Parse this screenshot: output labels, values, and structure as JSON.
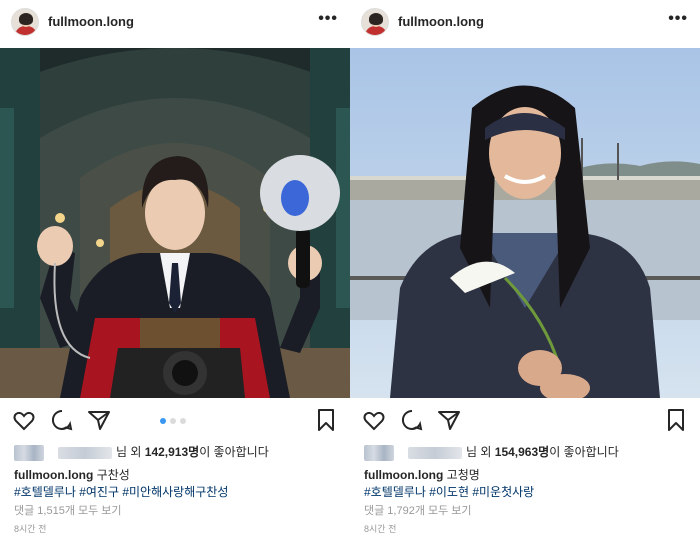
{
  "posts": [
    {
      "username": "fullmoon.long",
      "more": "•••",
      "likes_prefix": "님 외",
      "likes_count": "142,913명",
      "likes_suffix": "이 좋아합니다",
      "caption_user": "fullmoon.long",
      "caption_text": "구찬성",
      "hashtags": "#호텔델루나 #여진구 #미안해사랑해구찬성",
      "comments": "댓글 1,515개 모두 보기",
      "time": "8시간 전",
      "carousel_index": 1,
      "carousel_total": 3
    },
    {
      "username": "fullmoon.long",
      "more": "•••",
      "likes_prefix": "님 외",
      "likes_count": "154,963명",
      "likes_suffix": "이 좋아합니다",
      "caption_user": "fullmoon.long",
      "caption_text": "고청명",
      "hashtags": "#호텔델루나 #이도현 #미운첫사랑",
      "comments": "댓글 1,792개 모두 보기",
      "time": "8시간 전"
    }
  ],
  "icons": [
    "heart-icon",
    "comment-icon",
    "share-icon",
    "bookmark-icon"
  ],
  "colors": {
    "hashtag": "#003569",
    "muted": "#999999",
    "carousel_active": "#3897f0"
  }
}
